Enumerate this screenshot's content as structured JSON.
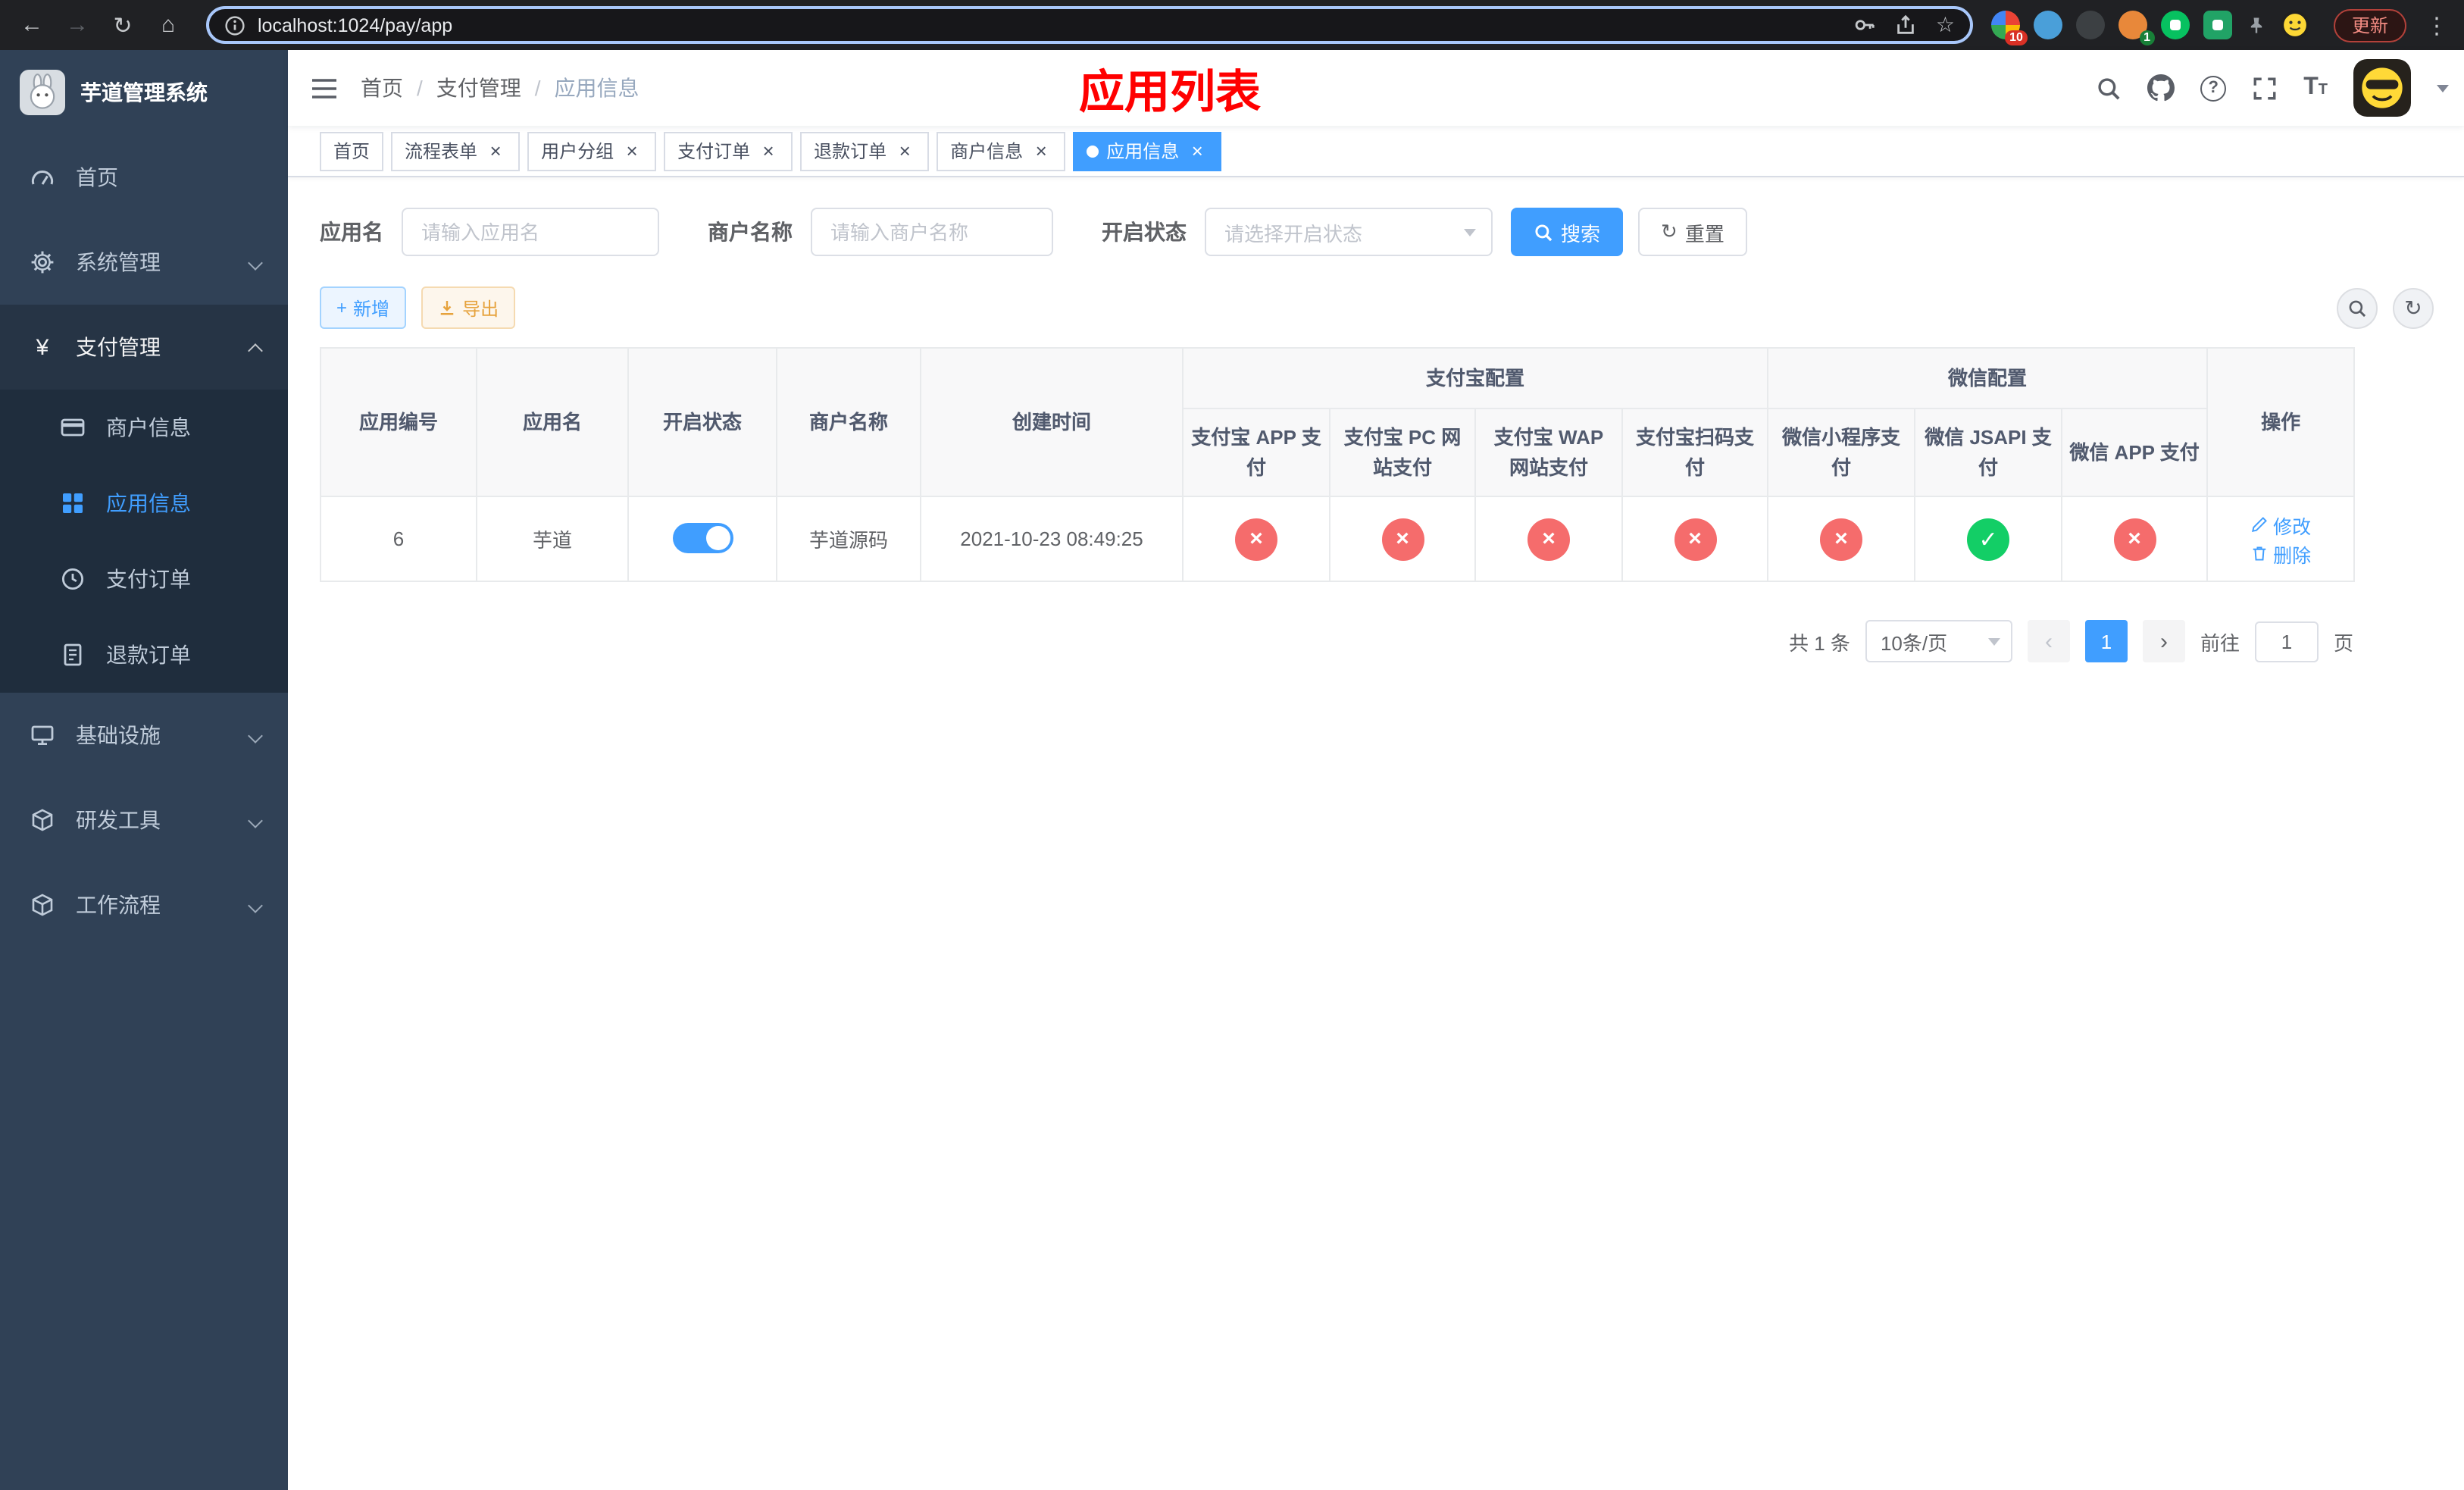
{
  "browser": {
    "url": "localhost:1024/pay/app",
    "update_label": "更新",
    "ext_badge_1": "10",
    "ext_badge_2": "1"
  },
  "sidebar": {
    "title": "芋道管理系统",
    "items": {
      "home": "首页",
      "system": "系统管理",
      "pay": "支付管理",
      "merchant": "商户信息",
      "app": "应用信息",
      "order": "支付订单",
      "refund": "退款订单",
      "infra": "基础设施",
      "dev": "研发工具",
      "workflow": "工作流程"
    }
  },
  "navbar": {
    "breadcrumb": [
      "首页",
      "支付管理",
      "应用信息"
    ],
    "page_title": "应用列表"
  },
  "tabs": [
    {
      "label": "首页",
      "closable": false,
      "active": false
    },
    {
      "label": "流程表单",
      "closable": true,
      "active": false
    },
    {
      "label": "用户分组",
      "closable": true,
      "active": false
    },
    {
      "label": "支付订单",
      "closable": true,
      "active": false
    },
    {
      "label": "退款订单",
      "closable": true,
      "active": false
    },
    {
      "label": "商户信息",
      "closable": true,
      "active": false
    },
    {
      "label": "应用信息",
      "closable": true,
      "active": true
    }
  ],
  "filters": {
    "app_name_label": "应用名",
    "app_name_placeholder": "请输入应用名",
    "merchant_name_label": "商户名称",
    "merchant_name_placeholder": "请输入商户名称",
    "status_label": "开启状态",
    "status_placeholder": "请选择开启状态",
    "search_label": "搜索",
    "reset_label": "重置"
  },
  "toolbar": {
    "add_label": "新增",
    "export_label": "导出"
  },
  "table": {
    "headers": {
      "app_id": "应用编号",
      "app_name": "应用名",
      "status": "开启状态",
      "merchant": "商户名称",
      "created": "创建时间",
      "alipay_group": "支付宝配置",
      "wechat_group": "微信配置",
      "alipay_app": "支付宝 APP 支付",
      "alipay_pc": "支付宝 PC 网站支付",
      "alipay_wap": "支付宝 WAP 网站支付",
      "alipay_qr": "支付宝扫码支付",
      "wx_lite": "微信小程序支付",
      "wx_jsapi": "微信 JSAPI 支付",
      "wx_app": "微信 APP 支付",
      "action": "操作"
    },
    "rows": [
      {
        "id": "6",
        "name": "芋道",
        "enabled": true,
        "merchant": "芋道源码",
        "created_at": "2021-10-23 08:49:25",
        "alipay_app": false,
        "alipay_pc": false,
        "alipay_wap": false,
        "alipay_qr": false,
        "wx_lite": false,
        "wx_jsapi": true,
        "wx_app": false
      }
    ],
    "actions": {
      "edit": "修改",
      "delete": "删除"
    }
  },
  "pagination": {
    "total": "共 1 条",
    "page_size": "10条/页",
    "page": "1",
    "goto_label": "前往",
    "goto_value": "1",
    "page_unit": "页"
  },
  "icons": {
    "back": "←",
    "forward": "→",
    "reload": "↻",
    "home": "⌂",
    "more": "⋮",
    "close": "×",
    "check": "✓",
    "cross": "×",
    "plus": "+",
    "yen": "¥",
    "prev": "‹",
    "next": "›",
    "star": "☆",
    "question": "?",
    "slash": "/",
    "text_size": "T",
    "refresh": "↻"
  },
  "colors": {
    "primary": "#409EFF",
    "success": "#13CE66",
    "danger": "#F56C6C",
    "warning": "#E6A23C",
    "title_red": "#FF0000",
    "sidebar_bg": "#304156"
  }
}
